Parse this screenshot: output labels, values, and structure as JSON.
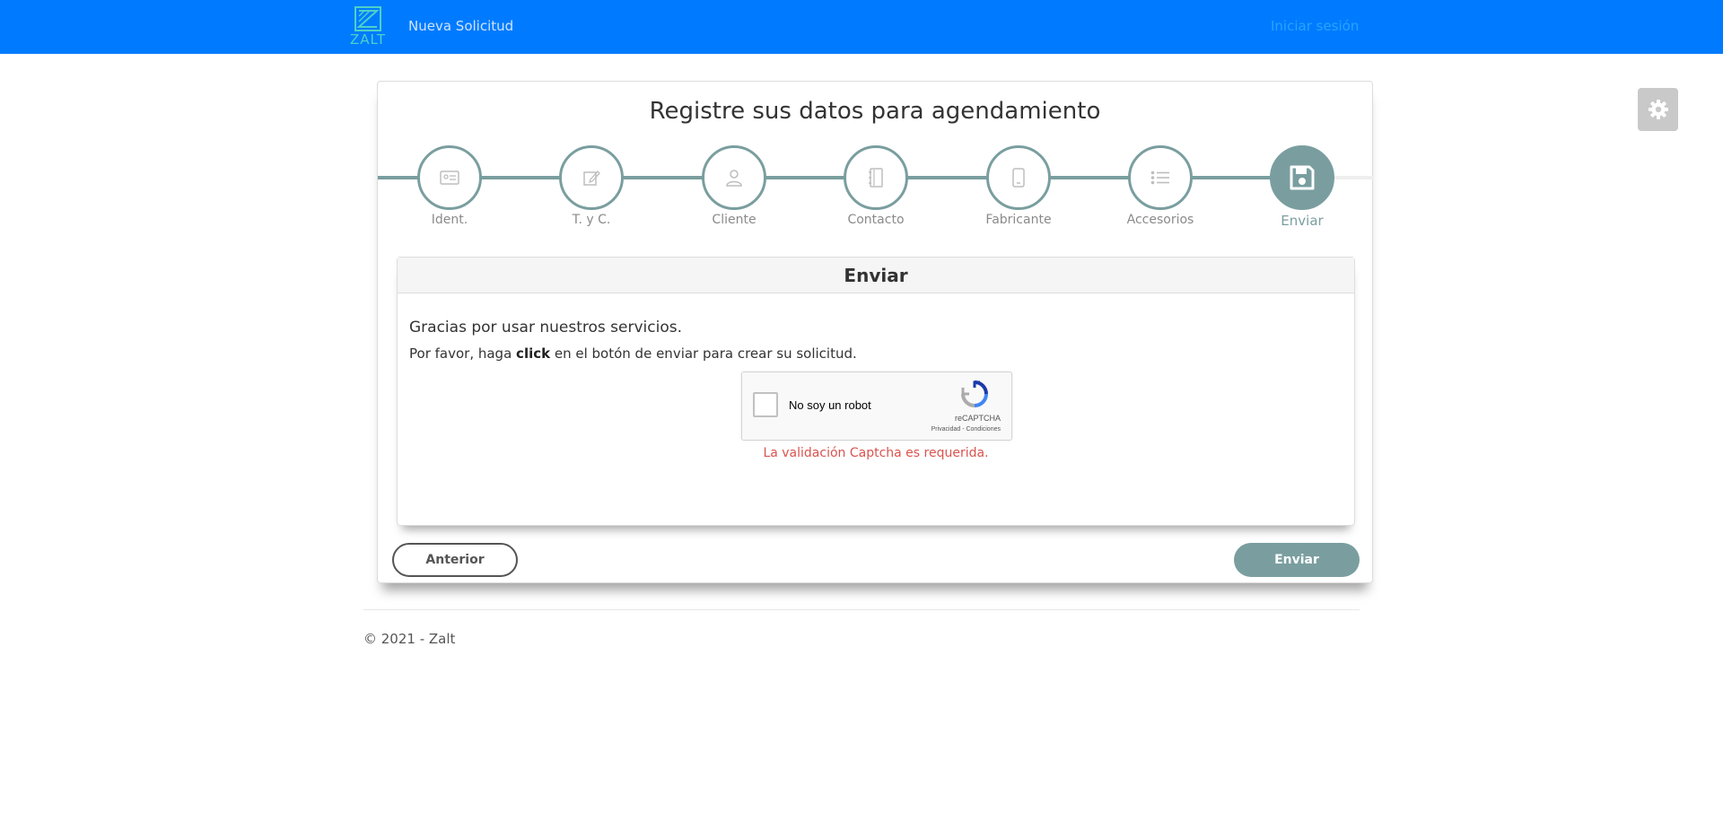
{
  "nav": {
    "brand": "ZALT",
    "new_request": "Nueva Solicitud",
    "login": "Iniciar sesión"
  },
  "page": {
    "title": "Registre sus datos para agendamiento"
  },
  "steps": [
    {
      "label": "Ident.",
      "icon": "id-card-icon",
      "active": false
    },
    {
      "label": "T. y C.",
      "icon": "edit-icon",
      "active": false
    },
    {
      "label": "Cliente",
      "icon": "user-icon",
      "active": false
    },
    {
      "label": "Contacto",
      "icon": "address-book-icon",
      "active": false
    },
    {
      "label": "Fabricante",
      "icon": "mobile-icon",
      "active": false
    },
    {
      "label": "Accesorios",
      "icon": "list-icon",
      "active": false
    },
    {
      "label": "Enviar",
      "icon": "save-icon",
      "active": true
    }
  ],
  "panel": {
    "heading": "Enviar",
    "thanks": "Gracias por usar nuestros servicios.",
    "instruction_pre": "Por favor, haga ",
    "instruction_bold": "click",
    "instruction_post": " en el botón de enviar para crear su solicitud."
  },
  "captcha": {
    "label": "No soy un robot",
    "brand": "reCAPTCHA",
    "links": "Privacidad - Condiciones",
    "error": "La validación Captcha es requerida."
  },
  "buttons": {
    "previous": "Anterior",
    "submit": "Enviar"
  },
  "footer": {
    "copyright": "© 2021 - Zalt"
  },
  "colors": {
    "navbar": "#007bff",
    "accent": "#7a9e9f",
    "error": "#d9534f"
  }
}
